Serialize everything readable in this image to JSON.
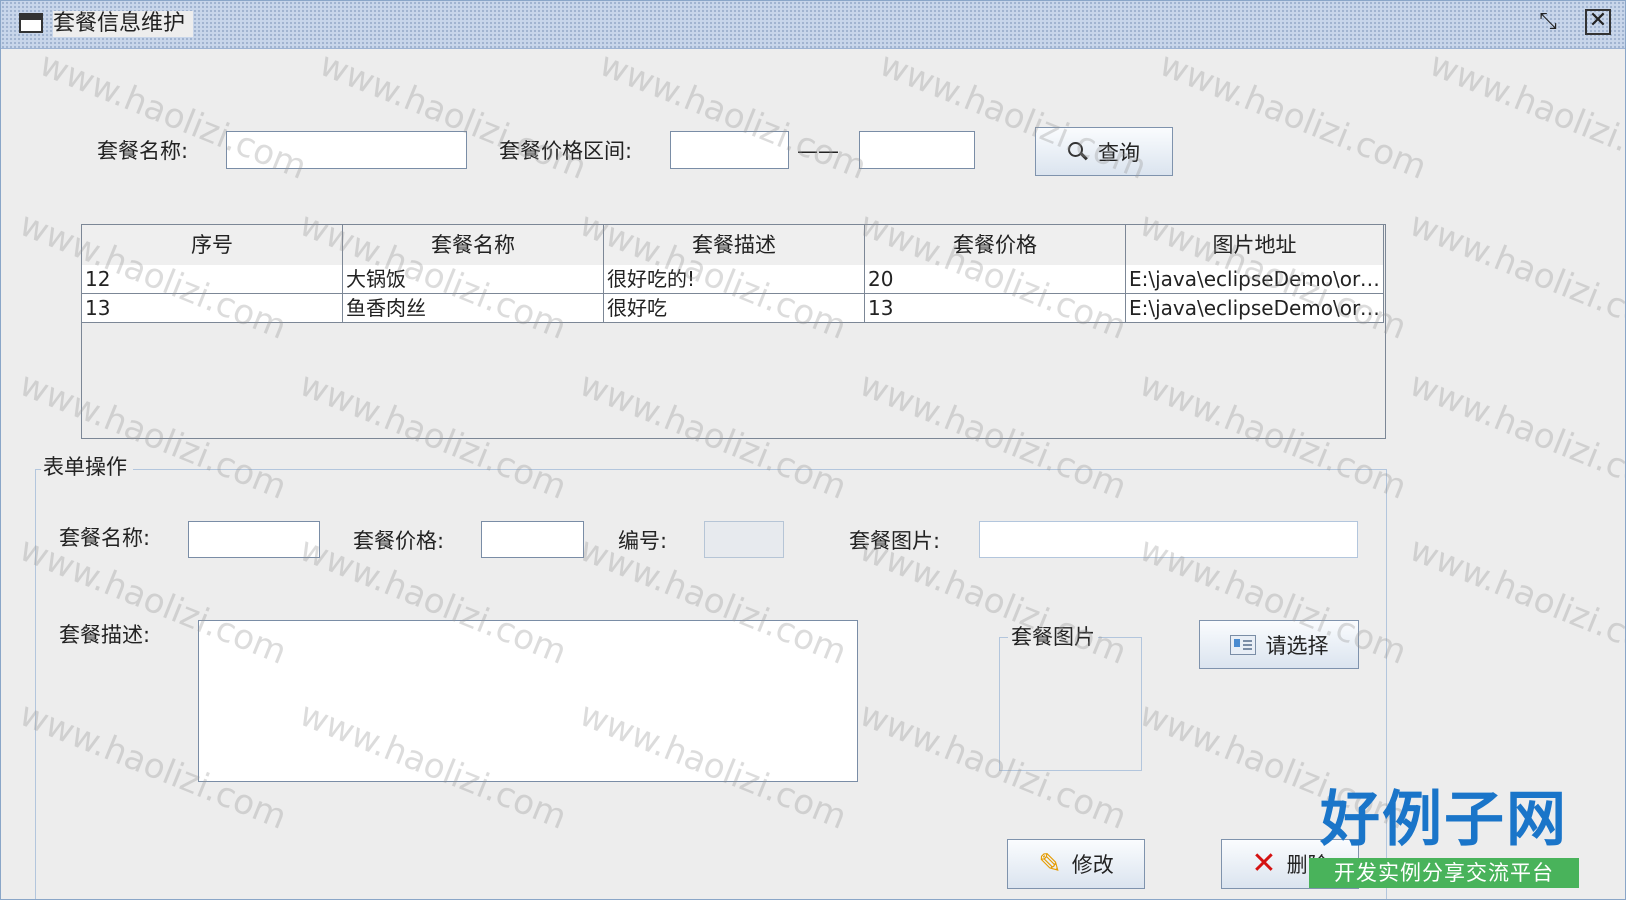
{
  "window": {
    "title": "套餐信息维护",
    "restore_icon": "restore-icon",
    "close_icon": "close-icon"
  },
  "search": {
    "name_label": "套餐名称:",
    "name_value": "",
    "price_range_label": "套餐价格区间:",
    "price_min_value": "",
    "price_separator": "——",
    "price_max_value": "",
    "query_button": "查询",
    "query_icon": "magnifier-icon"
  },
  "table": {
    "columns": [
      "序号",
      "套餐名称",
      "套餐描述",
      "套餐价格",
      "图片地址"
    ],
    "rows": [
      [
        "12",
        "大锅饭",
        "很好吃的!",
        "20",
        "E:\\java\\eclipseDemo\\ord..."
      ],
      [
        "13",
        "鱼香肉丝",
        "很好吃",
        "13",
        "E:\\java\\eclipseDemo\\ord..."
      ]
    ]
  },
  "form": {
    "group_title": "表单操作",
    "name_label": "套餐名称:",
    "name_value": "",
    "price_label": "套餐价格:",
    "price_value": "",
    "id_label": "编号:",
    "id_value": "",
    "image_label": "套餐图片:",
    "image_value": "",
    "desc_label": "套餐描述:",
    "desc_value": "",
    "image_box_title": "套餐图片",
    "choose_button": "请选择",
    "modify_button": "修改",
    "delete_button": "删除"
  },
  "watermark": "www.haolizi.com",
  "brand": {
    "name": "好例子网",
    "slogan": "开发实例分享交流平台"
  },
  "colors": {
    "title_bar": "#c8d6ea",
    "panel": "#ededed",
    "brand_blue": "#1a75c9",
    "brand_green": "#49b35b",
    "delete_red": "#d41212"
  }
}
